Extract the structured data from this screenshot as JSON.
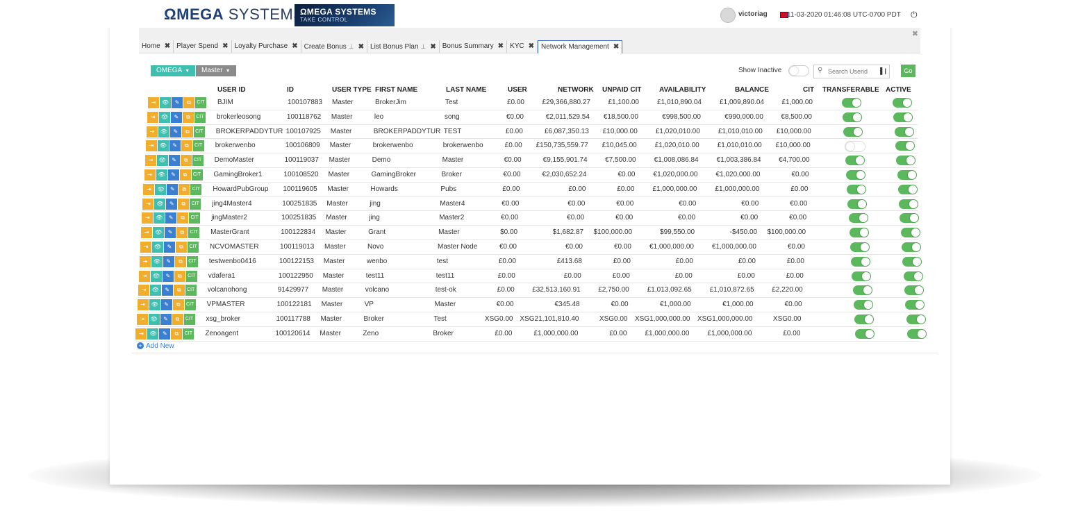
{
  "header": {
    "logo_omega": "ΩMEGA",
    "logo_systems": " SYSTEMS",
    "banner_title": "ΩMEGA SYSTEMS",
    "banner_sub": "TAKE CONTROL",
    "username": "victoriag",
    "datetime": "11-03-2020 01:46:08  UTC-0700 PDT",
    "power_icon": "⏻"
  },
  "tabs": [
    {
      "label": "Home",
      "pinned": false,
      "active": false
    },
    {
      "label": "Player Spend",
      "pinned": false,
      "active": false
    },
    {
      "label": "Loyalty Purchase",
      "pinned": false,
      "active": false
    },
    {
      "label": "Create Bonus",
      "pinned": true,
      "active": false
    },
    {
      "label": "List Bonus Plan",
      "pinned": true,
      "active": false
    },
    {
      "label": "Bonus Summary",
      "pinned": false,
      "active": false
    },
    {
      "label": "KYC",
      "pinned": false,
      "active": false
    },
    {
      "label": "Network Management",
      "pinned": false,
      "active": true
    }
  ],
  "toolbar": {
    "omega_label": "OMEGA",
    "master_label": "Master",
    "show_inactive": "Show Inactive",
    "search_placeholder": "Search Userid",
    "go_label": "Go"
  },
  "table": {
    "headers": [
      "USER ID",
      "ID",
      "USER TYPE",
      "FIRST NAME",
      "LAST NAME",
      "USER",
      "NETWORK",
      "UNPAID CIT",
      "AVAILABILITY",
      "BALANCE",
      "CIT",
      "TRANSFERABLE",
      "ACTIVE"
    ],
    "action_labels": [
      "⇥",
      "👁",
      "✎",
      "⧉",
      "CIT"
    ],
    "rows": [
      {
        "userid": "BJIM",
        "id": "100107883",
        "type": "Master",
        "first": "BrokerJim",
        "last": "Test",
        "user": "£0.00",
        "network": "£29,366,880.27",
        "unpaid": "£1,100.00",
        "avail": "£1,010,890.04",
        "balance": "£1,009,890.04",
        "cit": "£1,000.00",
        "transferable": true,
        "active": true
      },
      {
        "userid": "brokerleosong",
        "id": "100118762",
        "type": "Master",
        "first": "leo",
        "last": "song",
        "user": "€0.00",
        "network": "€2,011,529.54",
        "unpaid": "€18,500.00",
        "avail": "€998,500.00",
        "balance": "€990,000.00",
        "cit": "€8,500.00",
        "transferable": true,
        "active": true
      },
      {
        "userid": "BROKERPADDYTUR",
        "id": "100107925",
        "type": "Master",
        "first": "BROKERPADDYTUR",
        "last": "TEST",
        "user": "£0.00",
        "network": "£6,087,350.13",
        "unpaid": "£10,000.00",
        "avail": "£1,020,010.00",
        "balance": "£1,010,010.00",
        "cit": "£10,000.00",
        "transferable": true,
        "active": true
      },
      {
        "userid": "brokerwenbo",
        "id": "100106809",
        "type": "Master",
        "first": "brokerwenbo",
        "last": "brokerwenbo",
        "user": "£0.00",
        "network": "£150,735,559.77",
        "unpaid": "£10,045.00",
        "avail": "£1,020,010.00",
        "balance": "£1,010,010.00",
        "cit": "£10,000.00",
        "transferable": false,
        "active": true
      },
      {
        "userid": "DemoMaster",
        "id": "100119037",
        "type": "Master",
        "first": "Demo",
        "last": "Master",
        "user": "€0.00",
        "network": "€9,155,901.74",
        "unpaid": "€7,500.00",
        "avail": "€1,008,086.84",
        "balance": "€1,003,386.84",
        "cit": "€4,700.00",
        "transferable": true,
        "active": true
      },
      {
        "userid": "GamingBroker1",
        "id": "100108520",
        "type": "Master",
        "first": "GamingBroker",
        "last": "Broker",
        "user": "€0.00",
        "network": "€2,030,652.24",
        "unpaid": "€0.00",
        "avail": "€1,020,000.00",
        "balance": "€1,020,000.00",
        "cit": "€0.00",
        "transferable": true,
        "active": true
      },
      {
        "userid": "HowardPubGroup",
        "id": "100119605",
        "type": "Master",
        "first": "Howards",
        "last": "Pubs",
        "user": "£0.00",
        "network": "£0.00",
        "unpaid": "£0.00",
        "avail": "£1,000,000.00",
        "balance": "£1,000,000.00",
        "cit": "£0.00",
        "transferable": true,
        "active": true
      },
      {
        "userid": "jing4Master4",
        "id": "100251835",
        "type": "Master",
        "first": "jing",
        "last": "Master4",
        "user": "€0.00",
        "network": "€0.00",
        "unpaid": "€0.00",
        "avail": "€0.00",
        "balance": "€0.00",
        "cit": "€0.00",
        "transferable": true,
        "active": true
      },
      {
        "userid": "jingMaster2",
        "id": "100251835",
        "type": "Master",
        "first": "jing",
        "last": "Master2",
        "user": "€0.00",
        "network": "€0.00",
        "unpaid": "€0.00",
        "avail": "€0.00",
        "balance": "€0.00",
        "cit": "€0.00",
        "transferable": true,
        "active": true
      },
      {
        "userid": "MasterGrant",
        "id": "100122834",
        "type": "Master",
        "first": "Grant",
        "last": "Master",
        "user": "$0.00",
        "network": "$1,682.87",
        "unpaid": "$100,000.00",
        "avail": "$99,550.00",
        "balance": "-$450.00",
        "cit": "$100,000.00",
        "transferable": true,
        "active": true
      },
      {
        "userid": "NCVOMASTER",
        "id": "100119013",
        "type": "Master",
        "first": "Novo",
        "last": "Master Node",
        "user": "€0.00",
        "network": "€0.00",
        "unpaid": "€0.00",
        "avail": "€1,000,000.00",
        "balance": "€1,000,000.00",
        "cit": "€0.00",
        "transferable": true,
        "active": true
      },
      {
        "userid": "testwenbo0416",
        "id": "100122153",
        "type": "Master",
        "first": "wenbo",
        "last": "test",
        "user": "£0.00",
        "network": "£413.68",
        "unpaid": "£0.00",
        "avail": "£0.00",
        "balance": "£0.00",
        "cit": "£0.00",
        "transferable": true,
        "active": true
      },
      {
        "userid": "vdafera1",
        "id": "100122950",
        "type": "Master",
        "first": "test11",
        "last": "test11",
        "user": "£0.00",
        "network": "£0.00",
        "unpaid": "£0.00",
        "avail": "£0.00",
        "balance": "£0.00",
        "cit": "£0.00",
        "transferable": true,
        "active": true
      },
      {
        "userid": "volcanohong",
        "id": "91429977",
        "type": "Master",
        "first": "volcano",
        "last": "test-ok",
        "user": "£0.00",
        "network": "£32,513,160.91",
        "unpaid": "£2,750.00",
        "avail": "£1,013,092.65",
        "balance": "£1,010,872.65",
        "cit": "£2,220.00",
        "transferable": true,
        "active": true
      },
      {
        "userid": "VPMASTER",
        "id": "100122181",
        "type": "Master",
        "first": "VP",
        "last": "Master",
        "user": "€0.00",
        "network": "€345.48",
        "unpaid": "€0.00",
        "avail": "€1,000.00",
        "balance": "€1,000.00",
        "cit": "€0.00",
        "transferable": true,
        "active": true
      },
      {
        "userid": "xsg_broker",
        "id": "100117788",
        "type": "Master",
        "first": "Broker",
        "last": "Test",
        "user": "XSG0.00",
        "network": "XSG21,101,810.40",
        "unpaid": "XSG0.00",
        "avail": "XSG1,000,000.00",
        "balance": "XSG1,000,000.00",
        "cit": "XSG0.00",
        "transferable": true,
        "active": true
      },
      {
        "userid": "Zenoagent",
        "id": "100120614",
        "type": "Master",
        "first": "Zeno",
        "last": "Broker",
        "user": "£0.00",
        "network": "£1,000,000.00",
        "unpaid": "£0.00",
        "avail": "£1,000,000.00",
        "balance": "£1,000,000.00",
        "cit": "£0.00",
        "transferable": true,
        "active": true
      }
    ]
  },
  "add_new_label": "Add New"
}
